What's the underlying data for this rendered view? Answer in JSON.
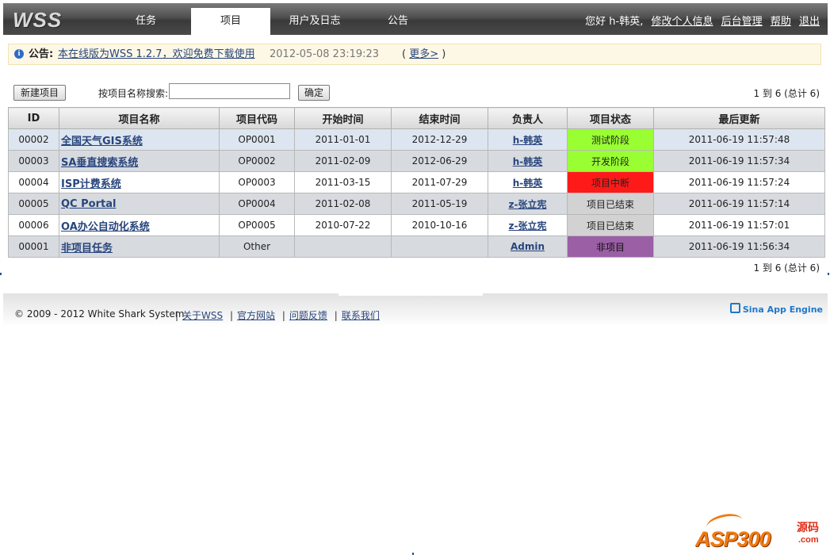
{
  "header": {
    "logo": "WSS",
    "tabs": [
      {
        "label": "任务",
        "active": false
      },
      {
        "label": "项目",
        "active": true
      },
      {
        "label": "用户及日志",
        "active": false
      },
      {
        "label": "公告",
        "active": false
      }
    ],
    "greeting": "您好 h-韩英,",
    "links": [
      "修改个人信息",
      "后台管理",
      "帮助",
      "退出"
    ]
  },
  "announcement": {
    "label": "公告:",
    "text": "本在线版为WSS 1.2.7，欢迎免费下载使用",
    "timestamp": "2012-05-08 23:19:23",
    "more_open": "(",
    "more_link": "更多>",
    "more_close": ")"
  },
  "toolbar": {
    "new_project_label": "新建项目",
    "search_label": "按项目名称搜索:",
    "search_value": "",
    "confirm_label": "确定",
    "pager_text": "1 到 6 (总计 6)"
  },
  "table": {
    "columns": [
      "ID",
      "项目名称",
      "项目代码",
      "开始时间",
      "结束时间",
      "负责人",
      "项目状态",
      "最后更新"
    ],
    "rows": [
      {
        "id": "00002",
        "name": "全国天气GIS系统",
        "code": "OP0001",
        "start": "2011-01-01",
        "end": "2012-12-29",
        "owner": "h-韩英",
        "status": "测试阶段",
        "status_color": "#99ff33",
        "updated": "2011-06-19 11:57:48",
        "style": "r-blue"
      },
      {
        "id": "00003",
        "name": "SA垂直搜索系统",
        "code": "OP0002",
        "start": "2011-02-09",
        "end": "2012-06-29",
        "owner": "h-韩英",
        "status": "开发阶段",
        "status_color": "#99ff33",
        "updated": "2011-06-19 11:57:34",
        "style": "r-gray"
      },
      {
        "id": "00004",
        "name": "ISP计费系统",
        "code": "OP0003",
        "start": "2011-03-15",
        "end": "2011-07-29",
        "owner": "h-韩英",
        "status": "项目中断",
        "status_color": "#ff1a1a",
        "updated": "2011-06-19 11:57:24",
        "style": "r-white"
      },
      {
        "id": "00005",
        "name": "QC Portal",
        "code": "OP0004",
        "start": "2011-02-08",
        "end": "2011-05-19",
        "owner": "z-张立宪",
        "status": "项目已结束",
        "status_color": "#d2d2d2",
        "updated": "2011-06-19 11:57:14",
        "style": "r-gray"
      },
      {
        "id": "00006",
        "name": "OA办公自动化系统",
        "code": "OP0005",
        "start": "2010-07-22",
        "end": "2010-10-16",
        "owner": "z-张立宪",
        "status": "项目已结束",
        "status_color": "#d2d2d2",
        "updated": "2011-06-19 11:57:01",
        "style": "r-white"
      },
      {
        "id": "00001",
        "name": "非项目任务",
        "code": "Other",
        "start": "",
        "end": "",
        "owner": "Admin",
        "status": "非项目",
        "status_color": "#9b5fa6",
        "updated": "2011-06-19 11:56:34",
        "style": "r-gray"
      }
    ]
  },
  "footer": {
    "copyright": "© 2009 - 2012 White Shark System",
    "links": [
      "关于WSS",
      "官方网站",
      "问题反馈",
      "联系我们"
    ],
    "badge": "Sina App Engine"
  },
  "watermark": {
    "brand": "ASP300",
    "side_top": "源码",
    "side_bottom": ".com"
  }
}
